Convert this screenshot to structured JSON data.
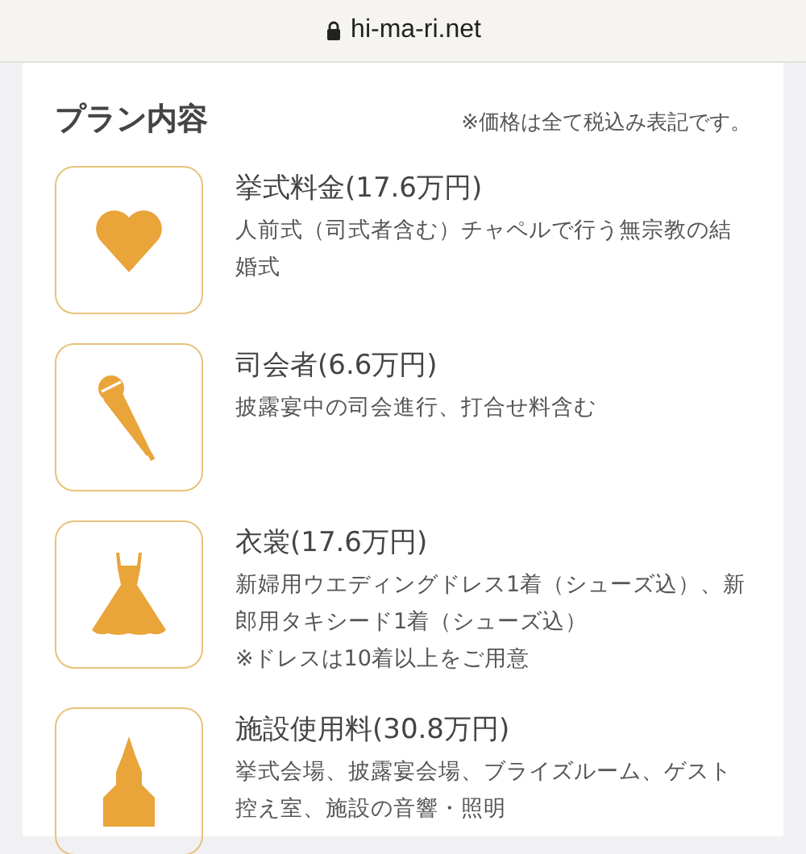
{
  "browser": {
    "url": "hi-ma-ri.net"
  },
  "section": {
    "title": "プラン内容",
    "note": "※価格は全て税込み表記です。"
  },
  "items": [
    {
      "kind": "heart",
      "title": "挙式料金(17.6万円)",
      "details": [
        "人前式（司式者含む）チャペルで行う無宗教の結婚式"
      ]
    },
    {
      "kind": "mic",
      "title": "司会者(6.6万円)",
      "details": [
        "披露宴中の司会進行、打合せ料含む"
      ]
    },
    {
      "kind": "dress",
      "title": "衣裳(17.6万円)",
      "details": [
        "新婦用ウエディングドレス1着（シューズ込）、新郎用タキシード1着（シューズ込）",
        "※ドレスは10着以上をご用意"
      ]
    },
    {
      "kind": "church",
      "title": "施設使用料(30.8万円)",
      "details": [
        "挙式会場、披露宴会場、ブライズルーム、ゲスト控え室、施設の音響・照明"
      ]
    }
  ]
}
